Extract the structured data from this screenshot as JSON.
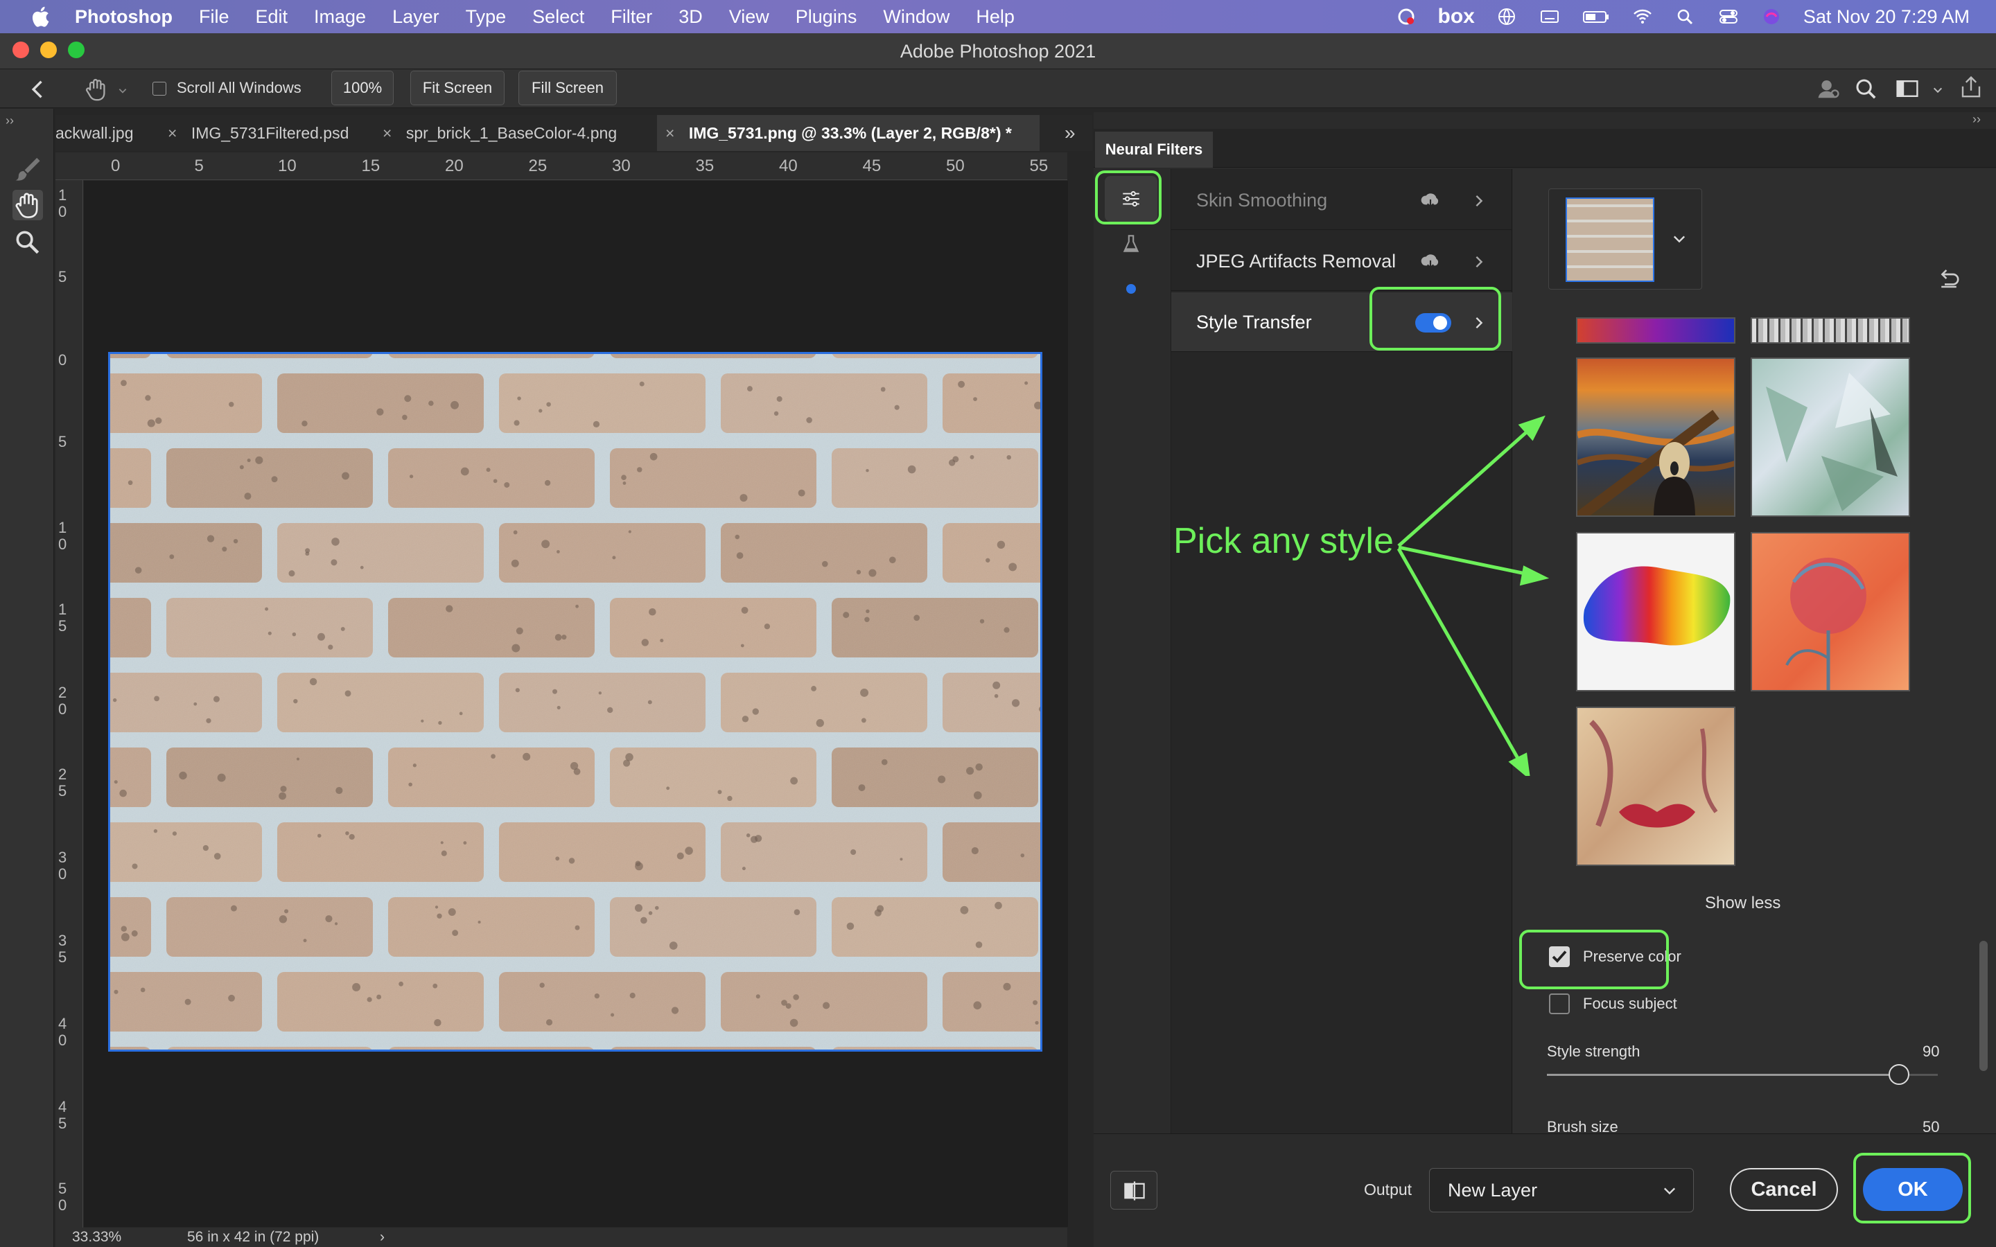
{
  "menubar": {
    "app": "Photoshop",
    "items": [
      "File",
      "Edit",
      "Image",
      "Layer",
      "Type",
      "Select",
      "Filter",
      "3D",
      "View",
      "Plugins",
      "Window",
      "Help"
    ],
    "box_label": "box",
    "datetime": "Sat Nov 20  7:29 AM"
  },
  "window": {
    "title": "Adobe Photoshop 2021"
  },
  "options": {
    "scroll_all_windows": "Scroll All Windows",
    "zoom": "100%",
    "fit_screen": "Fit Screen",
    "fill_screen": "Fill Screen"
  },
  "tabs": [
    {
      "label": "ackwall.jpg"
    },
    {
      "label": "IMG_5731Filtered.psd"
    },
    {
      "label": "spr_brick_1_BaseColor-4.png"
    },
    {
      "label": "IMG_5731.png @ 33.3% (Layer 2, RGB/8*) *"
    }
  ],
  "ruler": {
    "top": [
      "0",
      "5",
      "10",
      "15",
      "20",
      "25",
      "30",
      "35",
      "40",
      "45",
      "50",
      "55"
    ],
    "left": [
      "1\n0",
      "5",
      "0",
      "5",
      "1\n0",
      "1\n5",
      "2\n0",
      "2\n5",
      "3\n0",
      "3\n5",
      "4\n0",
      "4\n5",
      "5\n0"
    ]
  },
  "status": {
    "zoom": "33.33%",
    "doc_info": "56 in x 42 in (72 ppi)"
  },
  "neural_filters": {
    "panel_title": "Neural Filters",
    "filters": [
      {
        "label": "Skin Smoothing"
      },
      {
        "label": "JPEG Artifacts Removal"
      },
      {
        "label": "Style Transfer"
      }
    ],
    "style_transfer_enabled": true,
    "show_less": "Show less",
    "preserve_color": {
      "label": "Preserve color",
      "checked": true
    },
    "focus_subject": {
      "label": "Focus subject",
      "checked": false
    },
    "style_strength": {
      "label": "Style strength",
      "value": "90"
    },
    "brush_size": {
      "label": "Brush size",
      "value": "50"
    },
    "output_label": "Output",
    "output_value": "New Layer",
    "cancel": "Cancel",
    "ok": "OK"
  },
  "annotation": {
    "text": "Pick any style"
  },
  "colors": {
    "highlight": "#6df05a",
    "accent": "#2a6fe0",
    "ok_button": "#2b73e6"
  },
  "icons": [
    "apple-icon",
    "hand-tool-icon",
    "zoom-tool-icon",
    "brush-tool-icon",
    "sliders-icon",
    "flask-icon",
    "cloud-download-icon",
    "chevron-right-icon",
    "undo-icon",
    "compare-icon",
    "chevron-down-icon",
    "search-icon",
    "wifi-icon",
    "battery-icon",
    "back-arrow-icon",
    "share-icon"
  ]
}
